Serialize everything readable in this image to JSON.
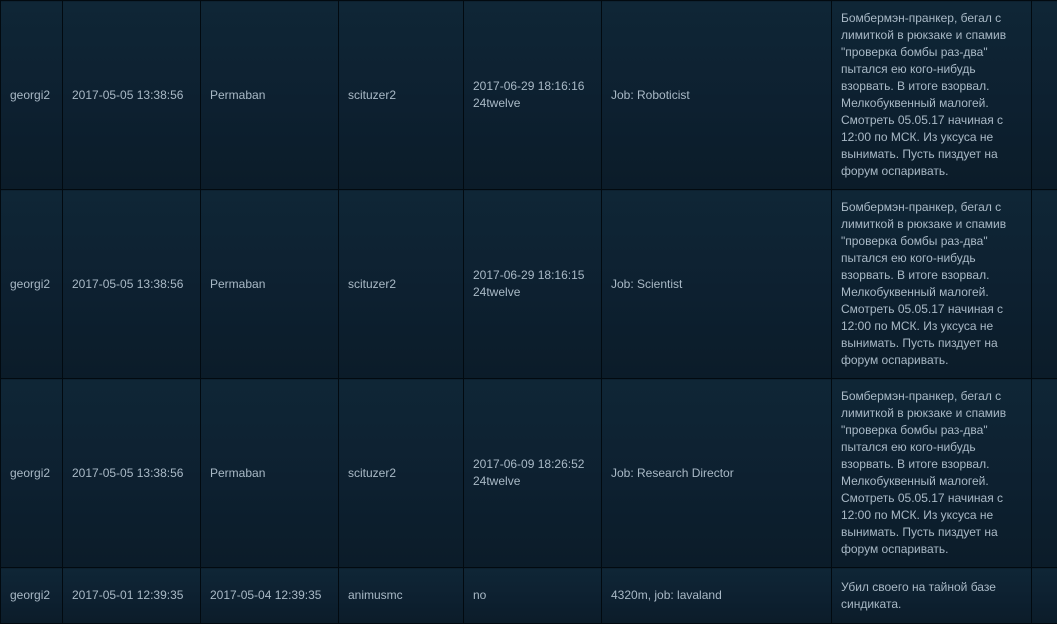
{
  "rows": [
    {
      "ckey": "georgi2",
      "ban_date": "2017-05-05 13:38:56",
      "expires": "Permaban",
      "admin": "scituzer2",
      "unban_date": "2017-06-29 18:16:16",
      "unban_by": "24twelve",
      "job": "Job: Roboticist",
      "reason": "Бомбермэн-пранкер, бегал с лимиткой в рюкзаке и спамив \"проверка бомбы раз-два\" пытался ею кого-нибудь взорвать. В итоге взорвал. Мелкобуквенный малогей. Смотреть 05.05.17 начиная с 12:00 по МСК. Из уксуса не вынимать. Пусть пиздует на форум оспаривать."
    },
    {
      "ckey": "georgi2",
      "ban_date": "2017-05-05 13:38:56",
      "expires": "Permaban",
      "admin": "scituzer2",
      "unban_date": "2017-06-29 18:16:15",
      "unban_by": "24twelve",
      "job": "Job: Scientist",
      "reason": "Бомбермэн-пранкер, бегал с лимиткой в рюкзаке и спамив \"проверка бомбы раз-два\" пытался ею кого-нибудь взорвать. В итоге взорвал. Мелкобуквенный малогей. Смотреть 05.05.17 начиная с 12:00 по МСК. Из уксуса не вынимать. Пусть пиздует на форум оспаривать."
    },
    {
      "ckey": "georgi2",
      "ban_date": "2017-05-05 13:38:56",
      "expires": "Permaban",
      "admin": "scituzer2",
      "unban_date": "2017-06-09 18:26:52",
      "unban_by": "24twelve",
      "job": "Job: Research Director",
      "reason": "Бомбермэн-пранкер, бегал с лимиткой в рюкзаке и спамив \"проверка бомбы раз-два\" пытался ею кого-нибудь взорвать. В итоге взорвал. Мелкобуквенный малогей. Смотреть 05.05.17 начиная с 12:00 по МСК. Из уксуса не вынимать. Пусть пиздует на форум оспаривать."
    },
    {
      "ckey": "georgi2",
      "ban_date": "2017-05-01 12:39:35",
      "expires": "2017-05-04 12:39:35",
      "admin": "animusmc",
      "unban_date": "no",
      "unban_by": "",
      "job": "4320m, job: lavaland",
      "reason": "Убил своего на тайной базе синдиката."
    }
  ]
}
